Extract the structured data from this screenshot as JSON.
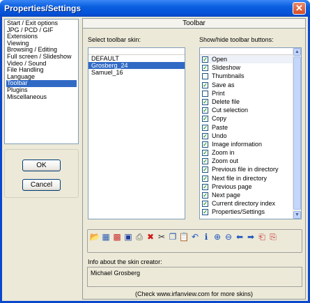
{
  "window": {
    "title": "Properties/Settings",
    "close_glyph": "✕"
  },
  "categories": [
    "Start / Exit options",
    "JPG / PCD / GIF",
    "Extensions",
    "Viewing",
    "Browsing / Editing",
    "Full screen / Slideshow",
    "Video / Sound",
    "File Handling",
    "Language",
    "Toolbar",
    "Plugins",
    "Miscellaneous"
  ],
  "selected_category": "Toolbar",
  "dialog_buttons": {
    "ok": "OK",
    "cancel": "Cancel"
  },
  "panel": {
    "title": "Toolbar",
    "skin_label": "Select toolbar skin:",
    "buttons_label": "Show/hide toolbar buttons:",
    "creator_label": "Info about the skin creator:",
    "creator_value": "Michael Grosberg",
    "footnote": "(Check   www.irfanview.com  for more skins)"
  },
  "skins": [
    {
      "label": "DEFAULT",
      "selected": false
    },
    {
      "label": "Grosberg_24",
      "selected": true
    },
    {
      "label": "Samuel_16",
      "selected": false
    }
  ],
  "toolbar_buttons": [
    {
      "label": "Open",
      "checked": true
    },
    {
      "label": "Slideshow",
      "checked": true
    },
    {
      "label": "Thumbnails",
      "checked": false
    },
    {
      "label": "Save as",
      "checked": true
    },
    {
      "label": "Print",
      "checked": false
    },
    {
      "label": "Delete file",
      "checked": true
    },
    {
      "label": "Cut selection",
      "checked": true
    },
    {
      "label": "Copy",
      "checked": true
    },
    {
      "label": "Paste",
      "checked": true
    },
    {
      "label": "Undo",
      "checked": true
    },
    {
      "label": "Image information",
      "checked": true
    },
    {
      "label": "Zoom in",
      "checked": true
    },
    {
      "label": "Zoom out",
      "checked": true
    },
    {
      "label": "Previous file in directory",
      "checked": true
    },
    {
      "label": "Next file in directory",
      "checked": true
    },
    {
      "label": "Previous page",
      "checked": true
    },
    {
      "label": "Next page",
      "checked": true
    },
    {
      "label": "Current directory index",
      "checked": true
    },
    {
      "label": "Properties/Settings",
      "checked": true
    }
  ],
  "preview_icons": [
    {
      "name": "open-folder-icon",
      "glyph": "📂",
      "color": "#d8a820"
    },
    {
      "name": "slideshow-icon",
      "glyph": "▦",
      "color": "#2a5db0"
    },
    {
      "name": "thumbnails-icon",
      "glyph": "▩",
      "color": "#c83030"
    },
    {
      "name": "save-icon",
      "glyph": "▣",
      "color": "#1f3fa0"
    },
    {
      "name": "print-icon",
      "glyph": "⎙",
      "color": "#555555"
    },
    {
      "name": "delete-icon",
      "glyph": "✖",
      "color": "#d01818"
    },
    {
      "name": "cut-icon",
      "glyph": "✂",
      "color": "#333333"
    },
    {
      "name": "copy-icon",
      "glyph": "❐",
      "color": "#2a5db0"
    },
    {
      "name": "paste-icon",
      "glyph": "📋",
      "color": "#b07a20"
    },
    {
      "name": "undo-icon",
      "glyph": "↶",
      "color": "#1f55c0"
    },
    {
      "name": "info-icon",
      "glyph": "ℹ",
      "color": "#1f55c0"
    },
    {
      "name": "zoom-in-icon",
      "glyph": "⊕",
      "color": "#1f55c0"
    },
    {
      "name": "zoom-out-icon",
      "glyph": "⊖",
      "color": "#1f55c0"
    },
    {
      "name": "previous-file-icon",
      "glyph": "⬅",
      "color": "#1f55c0"
    },
    {
      "name": "next-file-icon",
      "glyph": "➡",
      "color": "#1f55c0"
    },
    {
      "name": "previous-page-icon",
      "glyph": "⎗",
      "color": "#c83030"
    },
    {
      "name": "next-page-icon",
      "glyph": "⎘",
      "color": "#c83030"
    }
  ]
}
